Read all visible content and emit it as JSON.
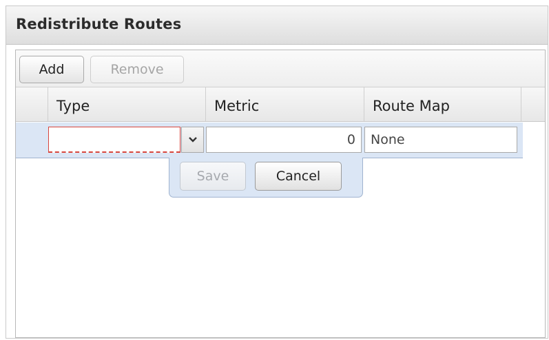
{
  "panel": {
    "title": "Redistribute Routes"
  },
  "toolbar": {
    "add_label": "Add",
    "remove_label": "Remove"
  },
  "columns": {
    "type": "Type",
    "metric": "Metric",
    "route_map": "Route Map"
  },
  "editor": {
    "type_value": "",
    "metric_value": "0",
    "route_map_value": "None",
    "save_label": "Save",
    "cancel_label": "Cancel"
  },
  "icons": {
    "dropdown": "chevron-down-icon"
  },
  "colors": {
    "edit_row_bg": "#dbe6f5",
    "invalid_border": "#d8453b"
  }
}
